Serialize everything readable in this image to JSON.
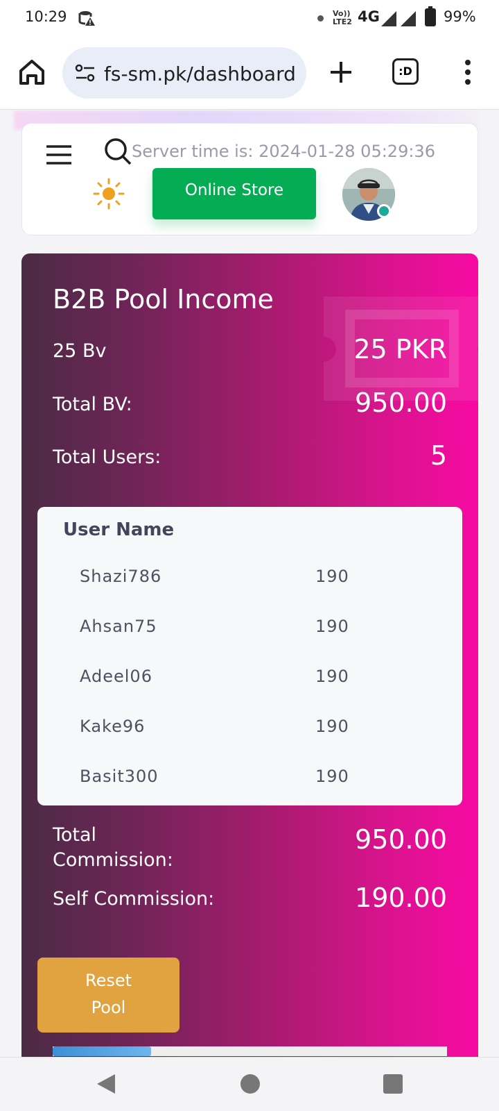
{
  "status_bar": {
    "time": "10:29",
    "network_volte": "Vo)) LTE2",
    "network_type": "4G",
    "battery": "99%"
  },
  "browser": {
    "url": "fs-sm.pk/dashboard",
    "tab_icon_text": ":D"
  },
  "header": {
    "server_time": "Server time is: 2024-01-28 05:29:36",
    "online_store_label": "Online Store"
  },
  "pool": {
    "title": "B2B Pool Income",
    "bv_label": "25 Bv",
    "bv_value": "25 PKR",
    "total_bv_label": "Total BV:",
    "total_bv_value": "950.00",
    "total_users_label": "Total Users:",
    "total_users_value": "5",
    "table_header": "User Name",
    "users": [
      {
        "name": "Shazi786",
        "value": "190"
      },
      {
        "name": "Ahsan75",
        "value": "190"
      },
      {
        "name": "Adeel06",
        "value": "190"
      },
      {
        "name": "Kake96",
        "value": "190"
      },
      {
        "name": "Basit300",
        "value": "190"
      }
    ],
    "total_commission_label": "Total Commission:",
    "total_commission_value": "950.00",
    "self_commission_label": "Self Commission:",
    "self_commission_value": "190.00",
    "reset_label": "Reset Pool",
    "progress_fraction": 0.25
  },
  "colors": {
    "online_store": "#04ad53",
    "reset_button": "#e1a33f",
    "card_gradient_start": "#4b2b44",
    "card_gradient_end": "#f70aa3"
  }
}
